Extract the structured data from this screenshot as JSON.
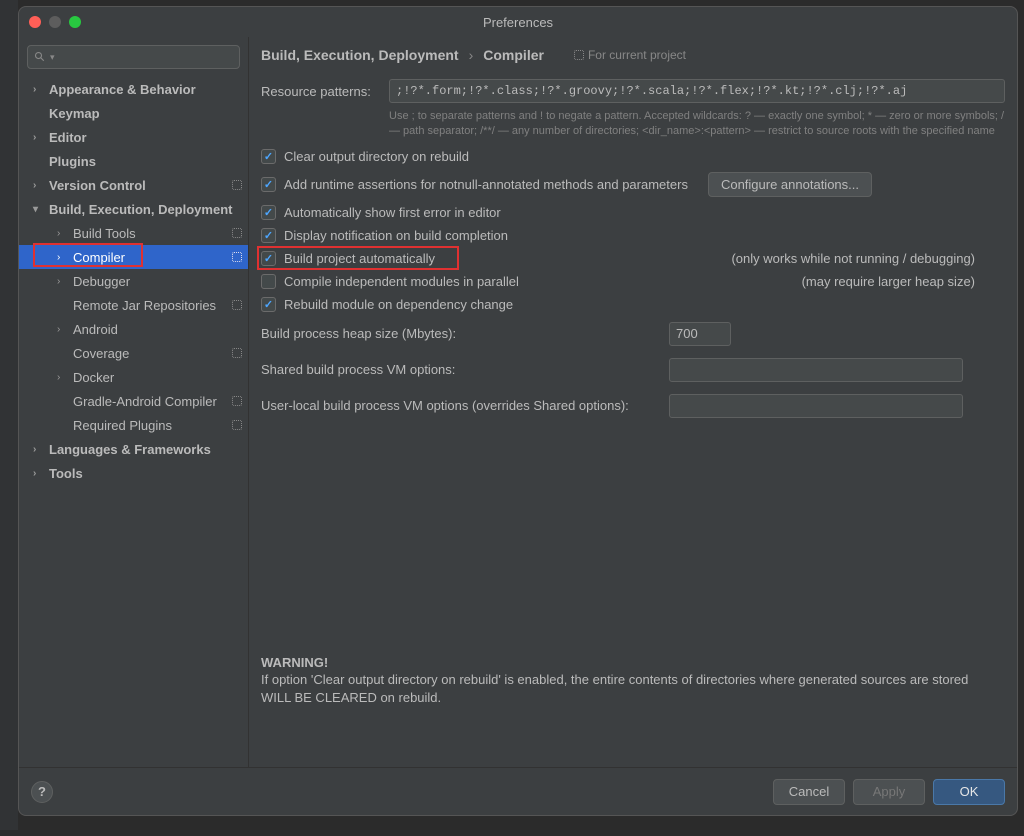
{
  "window": {
    "title": "Preferences"
  },
  "search": {
    "placeholder": ""
  },
  "sidebar": {
    "items": [
      {
        "label": "Appearance & Behavior",
        "expand": true,
        "bold": true,
        "level": 0
      },
      {
        "label": "Keymap",
        "expand": false,
        "bold": true,
        "level": 0
      },
      {
        "label": "Editor",
        "expand": true,
        "bold": true,
        "level": 0
      },
      {
        "label": "Plugins",
        "expand": false,
        "bold": true,
        "level": 0
      },
      {
        "label": "Version Control",
        "expand": true,
        "bold": true,
        "level": 0,
        "proj": true
      },
      {
        "label": "Build, Execution, Deployment",
        "expand": true,
        "open": true,
        "bold": true,
        "level": 0
      },
      {
        "label": "Build Tools",
        "expand": true,
        "level": 1,
        "proj": true
      },
      {
        "label": "Compiler",
        "expand": true,
        "level": 1,
        "selected": true,
        "proj": true
      },
      {
        "label": "Debugger",
        "expand": true,
        "level": 1
      },
      {
        "label": "Remote Jar Repositories",
        "expand": false,
        "level": 1,
        "proj": true
      },
      {
        "label": "Android",
        "expand": true,
        "level": 1
      },
      {
        "label": "Coverage",
        "expand": false,
        "level": 1,
        "proj": true
      },
      {
        "label": "Docker",
        "expand": true,
        "level": 1
      },
      {
        "label": "Gradle-Android Compiler",
        "expand": false,
        "level": 1,
        "proj": true
      },
      {
        "label": "Required Plugins",
        "expand": false,
        "level": 1,
        "proj": true
      },
      {
        "label": "Languages & Frameworks",
        "expand": true,
        "bold": true,
        "level": 0
      },
      {
        "label": "Tools",
        "expand": true,
        "bold": true,
        "level": 0
      }
    ]
  },
  "breadcrumb": {
    "a": "Build, Execution, Deployment",
    "b": "Compiler",
    "badge": "For current project"
  },
  "form": {
    "resource_patterns_label": "Resource patterns:",
    "resource_patterns_value": ";!?*.form;!?*.class;!?*.groovy;!?*.scala;!?*.flex;!?*.kt;!?*.clj;!?*.aj",
    "resource_hint": "Use ; to separate patterns and ! to negate a pattern. Accepted wildcards: ? — exactly one symbol; * — zero or more symbols; / — path separator; /**/ — any number of directories; <dir_name>:<pattern> — restrict to source roots with the specified name",
    "chk_clear": "Clear output directory on rebuild",
    "chk_runtime": "Add runtime assertions for notnull-annotated methods and parameters",
    "btn_configure": "Configure annotations...",
    "chk_autoerr": "Automatically show first error in editor",
    "chk_notif": "Display notification on build completion",
    "chk_autobuild": "Build project automatically",
    "note_autobuild": "(only works while not running / debugging)",
    "chk_parallel": "Compile independent modules in parallel",
    "note_parallel": "(may require larger heap size)",
    "chk_rebuild_dep": "Rebuild module on dependency change",
    "heap_label": "Build process heap size (Mbytes):",
    "heap_value": "700",
    "shared_vm_label": "Shared build process VM options:",
    "shared_vm_value": "",
    "user_vm_label": "User-local build process VM options (overrides Shared options):",
    "user_vm_value": "",
    "warning_head": "WARNING!",
    "warning_body": "If option 'Clear output directory on rebuild' is enabled, the entire contents of directories where generated sources are stored WILL BE CLEARED on rebuild."
  },
  "footer": {
    "cancel": "Cancel",
    "apply": "Apply",
    "ok": "OK"
  }
}
